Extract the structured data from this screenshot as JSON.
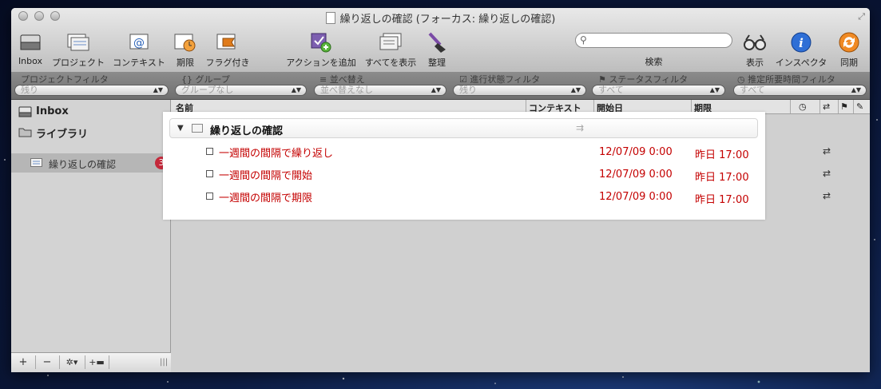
{
  "window": {
    "title": "繰り返しの確認 (フォーカス: 繰り返しの確認)"
  },
  "toolbar": {
    "inbox": "Inbox",
    "projects": "プロジェクト",
    "contexts": "コンテキスト",
    "due": "期限",
    "flagged": "フラグ付き",
    "add_action": "アクションを追加",
    "show_all": "すべてを表示",
    "clean_up": "整理",
    "search_label": "検索",
    "search_placeholder": "",
    "view": "表示",
    "inspector": "インスペクタ",
    "sync": "同期"
  },
  "filters": [
    {
      "label": "プロジェクトフィルタ",
      "value": "残り"
    },
    {
      "label": "グループ",
      "value": "グループなし"
    },
    {
      "label": "並べ替え",
      "value": "並べ替えなし"
    },
    {
      "label": "進行状態フィルタ",
      "value": "残り"
    },
    {
      "label": "ステータスフィルタ",
      "value": "すべて"
    },
    {
      "label": "推定所要時間フィルタ",
      "value": "すべて"
    }
  ],
  "sidebar": {
    "inbox": "Inbox",
    "library": "ライブラリ",
    "selected_project": "繰り返しの確認",
    "selected_count": "3",
    "bottom_buttons": [
      "+",
      "−",
      "✲▾",
      "+▬"
    ]
  },
  "columns": {
    "name": "名前",
    "context": "コンテキスト",
    "start": "開始日",
    "due": "期限"
  },
  "project": {
    "title": "繰り返しの確認"
  },
  "tasks": [
    {
      "name": "一週間の間隔で繰り返し",
      "start": "12/07/09 0:00",
      "due": "昨日 17:00"
    },
    {
      "name": "一週間の間隔で開始",
      "start": "12/07/09 0:00",
      "due": "昨日 17:00"
    },
    {
      "name": "一週間の間隔で期限",
      "start": "12/07/09 0:00",
      "due": "昨日 17:00"
    }
  ],
  "colors": {
    "overdue": "#c40000",
    "badge": "#c4283a",
    "desktop": "#0d1d45"
  }
}
